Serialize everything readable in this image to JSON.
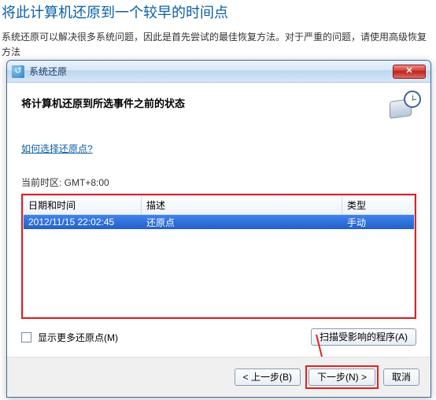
{
  "page": {
    "heading": "将此计算机还原到一个较早的时间点",
    "subtext": "系统还原可以解决很多系统问题，因此是首先尝试的最佳恢复方法。对于严重的问题，请使用高级恢复方法"
  },
  "window": {
    "title": "系统还原",
    "heading": "将计算机还原到所选事件之前的状态",
    "help_link": "如何选择还原点?",
    "timezone_label": "当前时区: GMT+8:00",
    "columns": {
      "c1": "日期和时间",
      "c2": "描述",
      "c3": "类型"
    },
    "rows": [
      {
        "datetime": "2012/11/15 22:02:45",
        "desc": "还原点",
        "type": "手动"
      }
    ],
    "show_more_label": "显示更多还原点(M)",
    "scan_button": "扫描受影响的程序(A)",
    "buttons": {
      "back": "< 上一步(B)",
      "next": "下一步(N) >",
      "cancel": "取消"
    }
  }
}
